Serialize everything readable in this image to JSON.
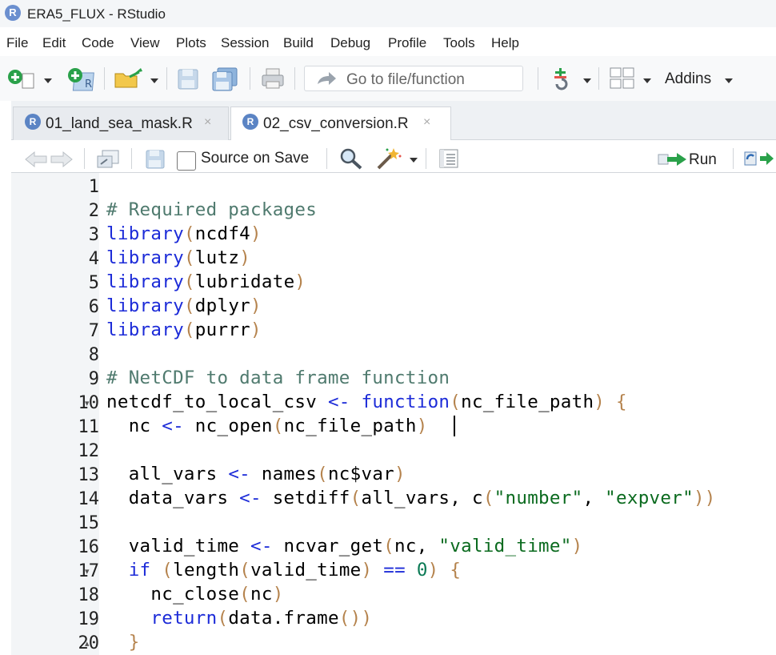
{
  "window": {
    "title": "ERA5_FLUX - RStudio",
    "app_icon": "R"
  },
  "menu": [
    "File",
    "Edit",
    "Code",
    "View",
    "Plots",
    "Session",
    "Build",
    "Debug",
    "Profile",
    "Tools",
    "Help"
  ],
  "toolbar": {
    "goto_placeholder": "Go to file/function",
    "addins_label": "Addins"
  },
  "tabs": [
    {
      "icon": "R",
      "label": "01_land_sea_mask.R",
      "close": "×",
      "active": false
    },
    {
      "icon": "R",
      "label": "02_csv_conversion.R",
      "close": "×",
      "active": true
    }
  ],
  "editor_toolbar": {
    "source_on_save": "Source on Save",
    "run_label": "Run"
  },
  "editor": {
    "line_numbers": [
      "1",
      "2",
      "3",
      "4",
      "5",
      "6",
      "7",
      "8",
      "9",
      "10",
      "11",
      "12",
      "13",
      "14",
      "15",
      "16",
      "17",
      "18",
      "19",
      "20"
    ],
    "lines": [
      "",
      "# Required packages",
      "library(ncdf4)",
      "library(lutz)",
      "library(lubridate)",
      "library(dplyr)",
      "library(purrr)",
      "",
      "# NetCDF to data frame function",
      "netcdf_to_local_csv <- function(nc_file_path) {",
      "  nc <- nc_open(nc_file_path)",
      "",
      "  all_vars <- names(nc$var)",
      "  data_vars <- setdiff(all_vars, c(\"number\", \"expver\"))",
      "",
      "  valid_time <- ncvar_get(nc, \"valid_time\")",
      "  if (length(valid_time) == 0) {",
      "    nc_close(nc)",
      "    return(data.frame())",
      "  }"
    ],
    "fold_markers": [
      {
        "line": "10",
        "glyph": "▾"
      },
      {
        "line": "17",
        "glyph": "▾"
      },
      {
        "line": "20",
        "glyph": "▴"
      }
    ]
  }
}
